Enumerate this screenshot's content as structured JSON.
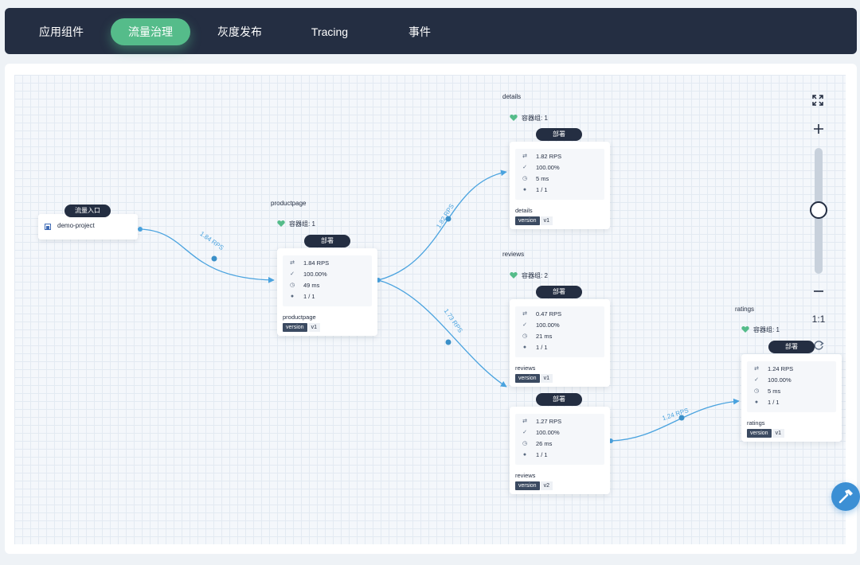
{
  "nav": {
    "tabs": [
      {
        "label": "应用组件"
      },
      {
        "label": "流量治理"
      },
      {
        "label": "灰度发布"
      },
      {
        "label": "Tracing"
      },
      {
        "label": "事件"
      }
    ],
    "active_tab": "流量治理"
  },
  "entry": {
    "badge": "流量入口",
    "project": "demo-project"
  },
  "groups": {
    "productpage": {
      "title": "productpage",
      "pods": "容器组: 1"
    },
    "details": {
      "title": "details",
      "pods": "容器组: 1"
    },
    "reviews": {
      "title": "reviews",
      "pods": "容器组: 2"
    },
    "ratings": {
      "title": "ratings",
      "pods": "容器组: 1"
    }
  },
  "cards": {
    "productpage": {
      "badge": "部署",
      "rps": "1.84 RPS",
      "success": "100.00%",
      "latency": "49 ms",
      "replicas": "1 / 1",
      "name": "productpage",
      "version_key": "version",
      "version": "v1"
    },
    "details": {
      "badge": "部署",
      "rps": "1.82 RPS",
      "success": "100.00%",
      "latency": "5 ms",
      "replicas": "1 / 1",
      "name": "details",
      "version_key": "version",
      "version": "v1"
    },
    "reviews_v1": {
      "badge": "部署",
      "rps": "0.47 RPS",
      "success": "100.00%",
      "latency": "21 ms",
      "replicas": "1 / 1",
      "name": "reviews",
      "version_key": "version",
      "version": "v1"
    },
    "reviews_v2": {
      "badge": "部署",
      "rps": "1.27 RPS",
      "success": "100.00%",
      "latency": "26 ms",
      "replicas": "1 / 1",
      "name": "reviews",
      "version_key": "version",
      "version": "v2"
    },
    "ratings": {
      "badge": "部署",
      "rps": "1.24 RPS",
      "success": "100.00%",
      "latency": "5 ms",
      "replicas": "1 / 1",
      "name": "ratings",
      "version_key": "version",
      "version": "v1"
    }
  },
  "edges": {
    "entry_to_productpage": "1.84 RPS",
    "productpage_to_details": "1.82 RPS",
    "productpage_to_reviews": "1.73 RPS",
    "reviews_to_ratings": "1.24 RPS"
  },
  "zoom": {
    "ratio": "1:1",
    "level": 0.5
  },
  "colors": {
    "nav_bg": "#242e42",
    "accent": "#55bc8a",
    "edge": "#4aa3df",
    "health": "#55bc8a"
  },
  "icons": [
    "expand-icon",
    "zoom-in-icon",
    "zoom-out-icon",
    "refresh-icon",
    "hammer-icon",
    "heart-icon",
    "traffic-icon",
    "check-icon",
    "clock-icon",
    "user-icon",
    "project-icon"
  ]
}
